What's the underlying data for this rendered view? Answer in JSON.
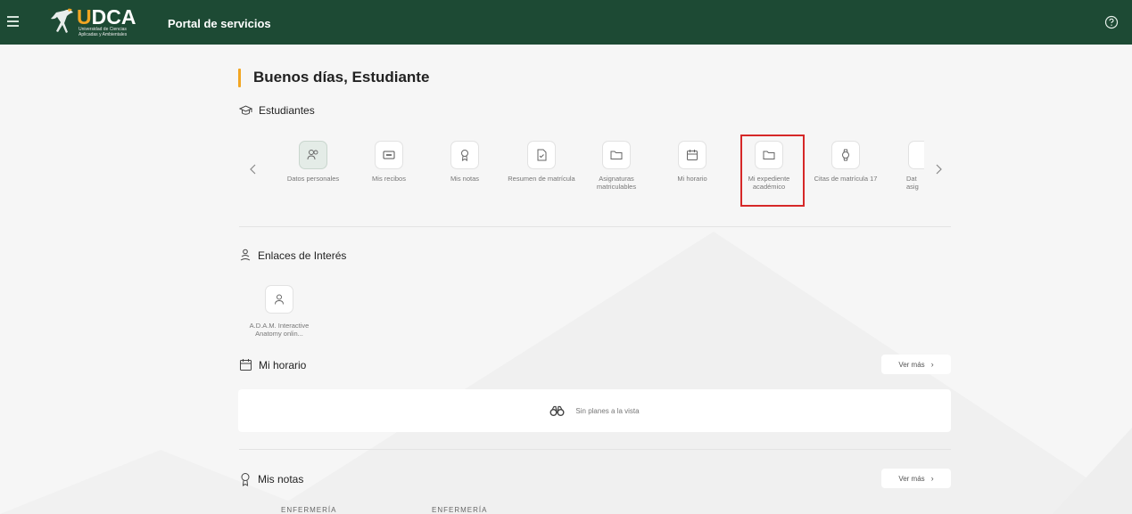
{
  "header": {
    "logo_word_left": "U",
    "logo_word_right": "DCA",
    "logo_subtitle_1": "Universidad de Ciencias",
    "logo_subtitle_2": "Aplicadas y Ambientales",
    "title": "Portal de servicios",
    "menu_icon": "hamburger-icon",
    "help_icon": "help-circle-icon"
  },
  "greeting": "Buenos días, Estudiante",
  "students_section": {
    "title": "Estudiantes",
    "icon": "graduation-cap-icon",
    "tiles": [
      {
        "label": "Datos personales",
        "icon": "user-group-icon"
      },
      {
        "label": "Mis recibos",
        "icon": "receipt-icon"
      },
      {
        "label": "Mis notas",
        "icon": "award-icon"
      },
      {
        "label": "Resumen de matrícula",
        "icon": "document-check-icon"
      },
      {
        "label": "Asignaturas matriculables",
        "icon": "folder-icon"
      },
      {
        "label": "Mi horario",
        "icon": "calendar-icon"
      },
      {
        "label": "Mi expediente académico",
        "icon": "folder-icon"
      },
      {
        "label": "Citas de matrícula 17",
        "icon": "watch-icon"
      },
      {
        "label": "Dat asig",
        "icon": "partial-icon"
      }
    ]
  },
  "links_section": {
    "title": "Enlaces de Interés",
    "icon": "people-icon",
    "links": [
      {
        "label": "A.D.A.M. Interactive Anatomy onlin...",
        "icon": "user-icon"
      }
    ]
  },
  "schedule_section": {
    "title": "Mi horario",
    "icon": "calendar-icon",
    "ver_mas": "Ver más",
    "empty_text": "Sin planes a la vista",
    "empty_icon": "binoculars-icon"
  },
  "grades_section": {
    "title": "Mis notas",
    "icon": "award-icon",
    "ver_mas": "Ver más",
    "courses": [
      "ENFERMERÍA",
      "ENFERMERÍA"
    ]
  },
  "colors": {
    "header_bg": "#1d4a34",
    "accent": "#f2a623",
    "highlight_border": "#d62828"
  }
}
